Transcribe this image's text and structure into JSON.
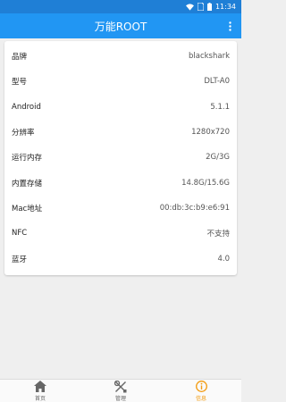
{
  "status_bar": {
    "time": "11:34"
  },
  "app_bar": {
    "title": "万能ROOT"
  },
  "info_rows": [
    {
      "label": "品牌",
      "value": "blackshark"
    },
    {
      "label": "型号",
      "value": "DLT-A0"
    },
    {
      "label": "Android",
      "value": "5.1.1"
    },
    {
      "label": "分辨率",
      "value": "1280x720"
    },
    {
      "label": "运行内存",
      "value": "2G/3G"
    },
    {
      "label": "内置存储",
      "value": "14.8G/15.6G"
    },
    {
      "label": "Mac地址",
      "value": "00:db:3c:b9:e6:91"
    },
    {
      "label": "NFC",
      "value": "不支持"
    },
    {
      "label": "蓝牙",
      "value": "4.0"
    }
  ],
  "bottom_nav": {
    "items": [
      {
        "label": "首页",
        "icon": "home-icon"
      },
      {
        "label": "管理",
        "icon": "tools-icon"
      },
      {
        "label": "信息",
        "icon": "info-icon",
        "active": true
      }
    ]
  },
  "colors": {
    "primary": "#2196f3",
    "status_bar": "#1f7fd6",
    "active_tab": "#f39c12"
  }
}
